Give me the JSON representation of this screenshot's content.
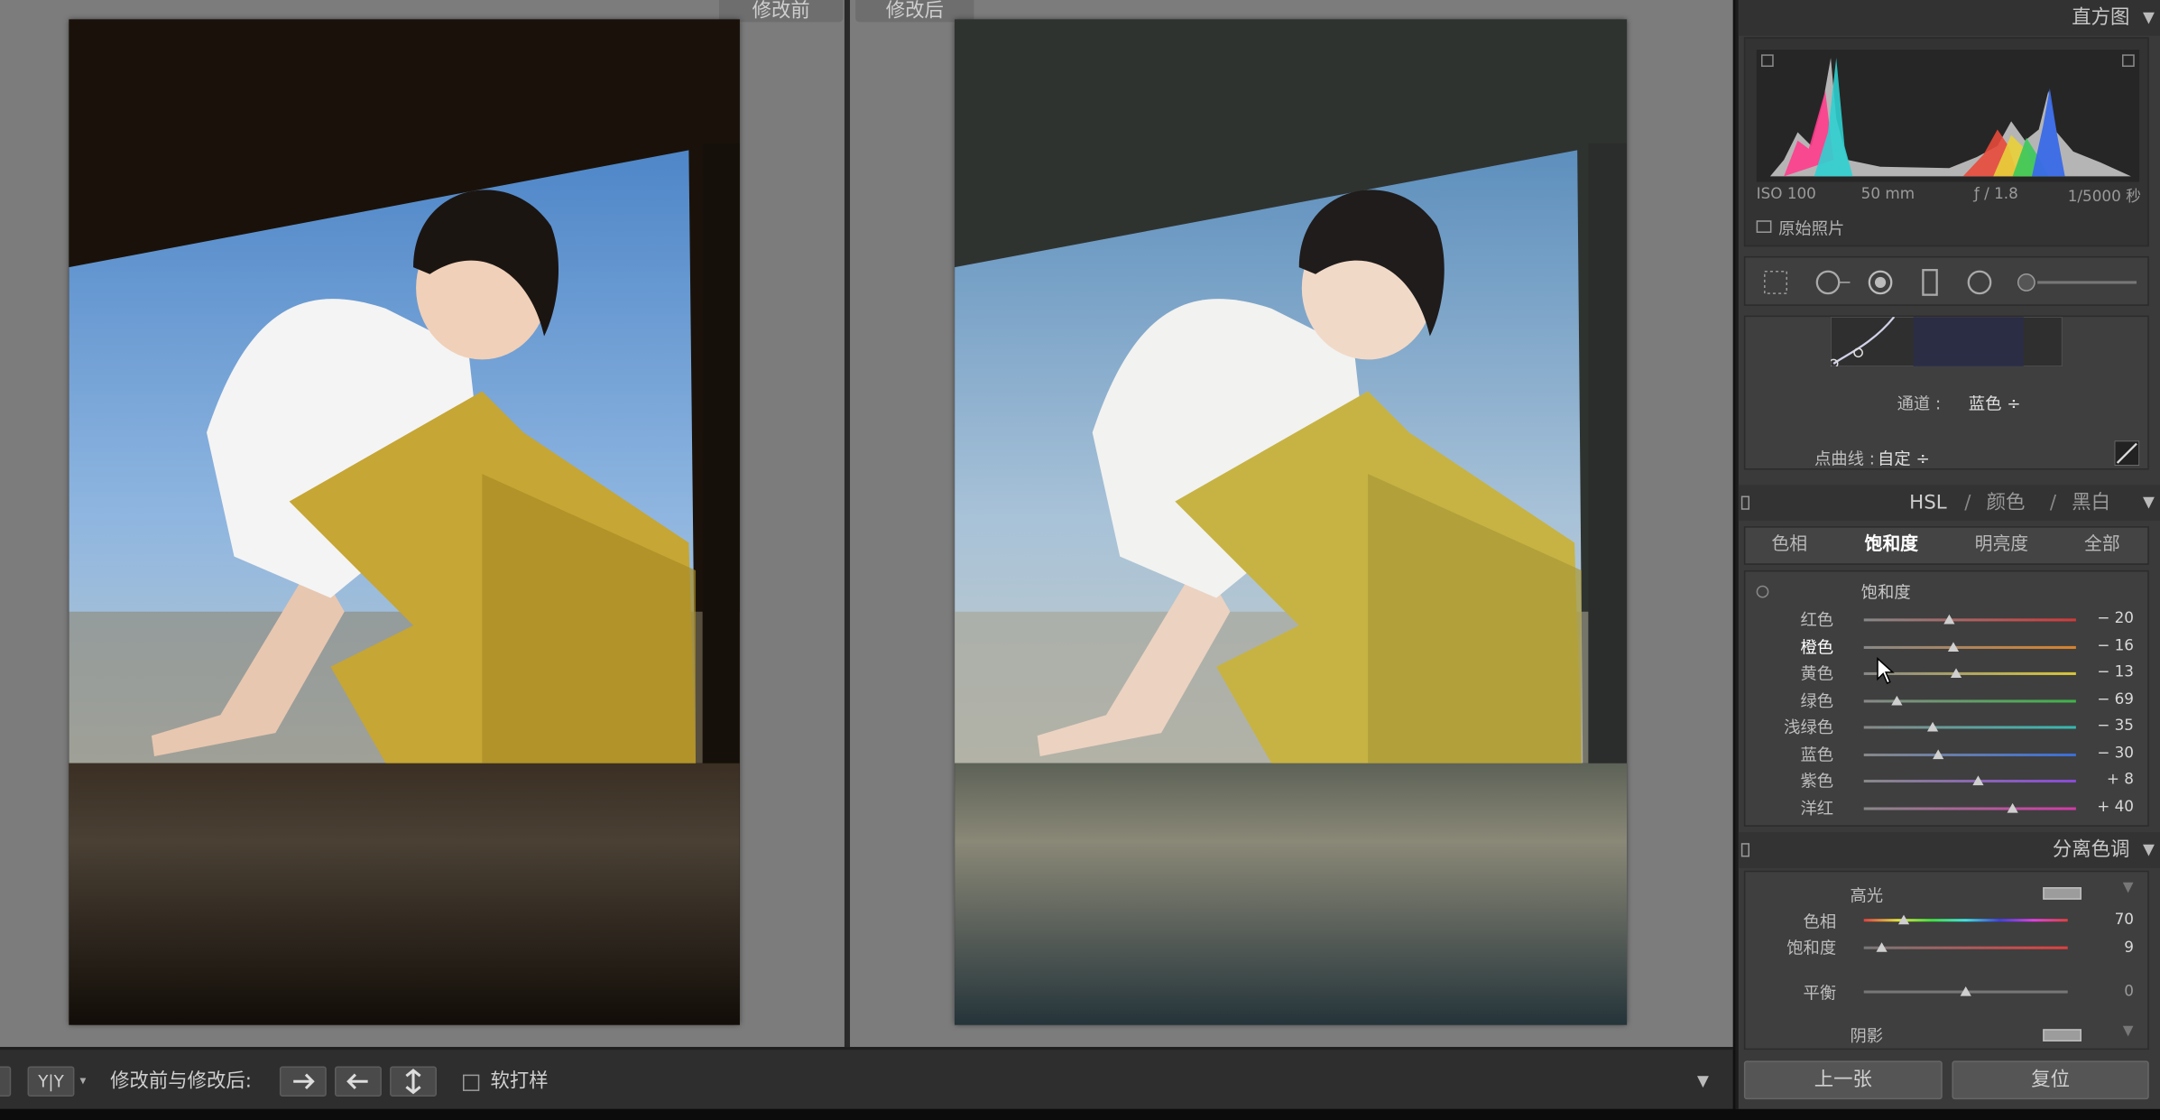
{
  "compare": {
    "before_label": "修改前",
    "after_label": "修改后"
  },
  "toolbar": {
    "view_mode_label": "Y|Y",
    "compare_label": "修改前与修改后:",
    "soft_proof_label": "软打样"
  },
  "histogram": {
    "title": "直方图",
    "iso": "ISO 100",
    "focal_length": "50 mm",
    "aperture": "ƒ / 1.8",
    "shutter": "1/5000 秒",
    "original_photo_label": "原始照片"
  },
  "tone_curve": {
    "channel_label": "通道 :",
    "channel_value": "蓝色 ÷",
    "point_curve_label": "点曲线 :",
    "point_curve_value": "自定 ÷"
  },
  "hsl": {
    "header_hsl": "HSL",
    "header_color": "颜色",
    "header_bw": "黑白",
    "sep": "/",
    "tabs": [
      "色相",
      "饱和度",
      "明亮度",
      "全部"
    ],
    "active_tab": "饱和度",
    "section_label": "饱和度",
    "sliders": [
      {
        "label": "红色",
        "value": "− 20",
        "amount": -20,
        "gradient": [
          "#888888",
          "#d23a3a"
        ]
      },
      {
        "label": "橙色",
        "value": "− 16",
        "amount": -16,
        "gradient": [
          "#888888",
          "#d9822b"
        ]
      },
      {
        "label": "黄色",
        "value": "− 13",
        "amount": -13,
        "gradient": [
          "#888888",
          "#d8c53a"
        ]
      },
      {
        "label": "绿色",
        "value": "− 69",
        "amount": -69,
        "gradient": [
          "#888888",
          "#3fb34a"
        ]
      },
      {
        "label": "浅绿色",
        "value": "− 35",
        "amount": -35,
        "gradient": [
          "#888888",
          "#35b8b0"
        ]
      },
      {
        "label": "蓝色",
        "value": "− 30",
        "amount": -30,
        "gradient": [
          "#888888",
          "#3a6fd8"
        ]
      },
      {
        "label": "紫色",
        "value": "+ 8",
        "amount": 8,
        "gradient": [
          "#888888",
          "#8a4ad8"
        ]
      },
      {
        "label": "洋红",
        "value": "+ 40",
        "amount": 40,
        "gradient": [
          "#888888",
          "#d23aa8"
        ]
      }
    ]
  },
  "split_toning": {
    "title": "分离色调",
    "highlights_label": "高光",
    "hue_label": "色相",
    "hue_value": "70",
    "hue_amount": 70,
    "saturation_label": "饱和度",
    "saturation_value": "9",
    "saturation_amount": 9,
    "balance_label": "平衡",
    "balance_value": "0",
    "balance_amount": 0,
    "shadows_label": "阴影"
  },
  "nav": {
    "prev_label": "上一张",
    "reset_label": "复位"
  },
  "colors": {
    "panel_bg": "#3a3a3a",
    "compare_bg": "#7c7c7c",
    "accent_text": "#ffffff"
  }
}
